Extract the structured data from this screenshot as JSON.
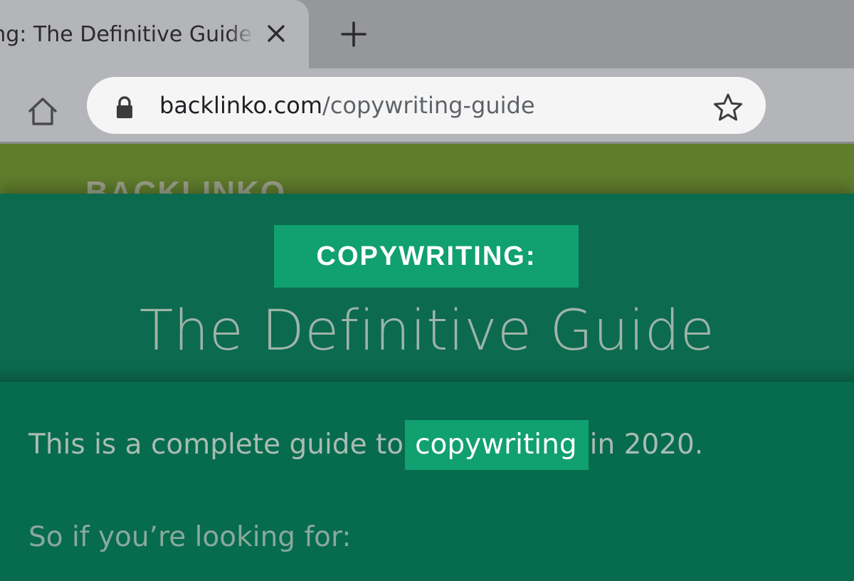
{
  "browser": {
    "tab": {
      "title": "Copywriting: The Definitive Guide",
      "close_icon": "close-icon"
    },
    "new_tab_icon": "plus-icon",
    "home_icon": "home-icon",
    "omnibox": {
      "lock_icon": "lock-icon",
      "url_host": "backlinko.com",
      "url_path": "/copywriting-guide",
      "star_icon": "star-icon"
    }
  },
  "site": {
    "logo_text": "BACKLINKO"
  },
  "hero": {
    "badge": "COPYWRITING:",
    "title": "The Definitive Guide"
  },
  "content": {
    "intro_before": "This is a complete guide to",
    "intro_highlight": "copywriting",
    "intro_after": "in 2020.",
    "second_line": "So if you’re looking for:"
  },
  "colors": {
    "tabbar": "#96979b",
    "toolbar": "#b4b5b8",
    "site_header": "#5f7d2c",
    "page_bg": "#0a6a4e",
    "accent": "#11a070"
  }
}
